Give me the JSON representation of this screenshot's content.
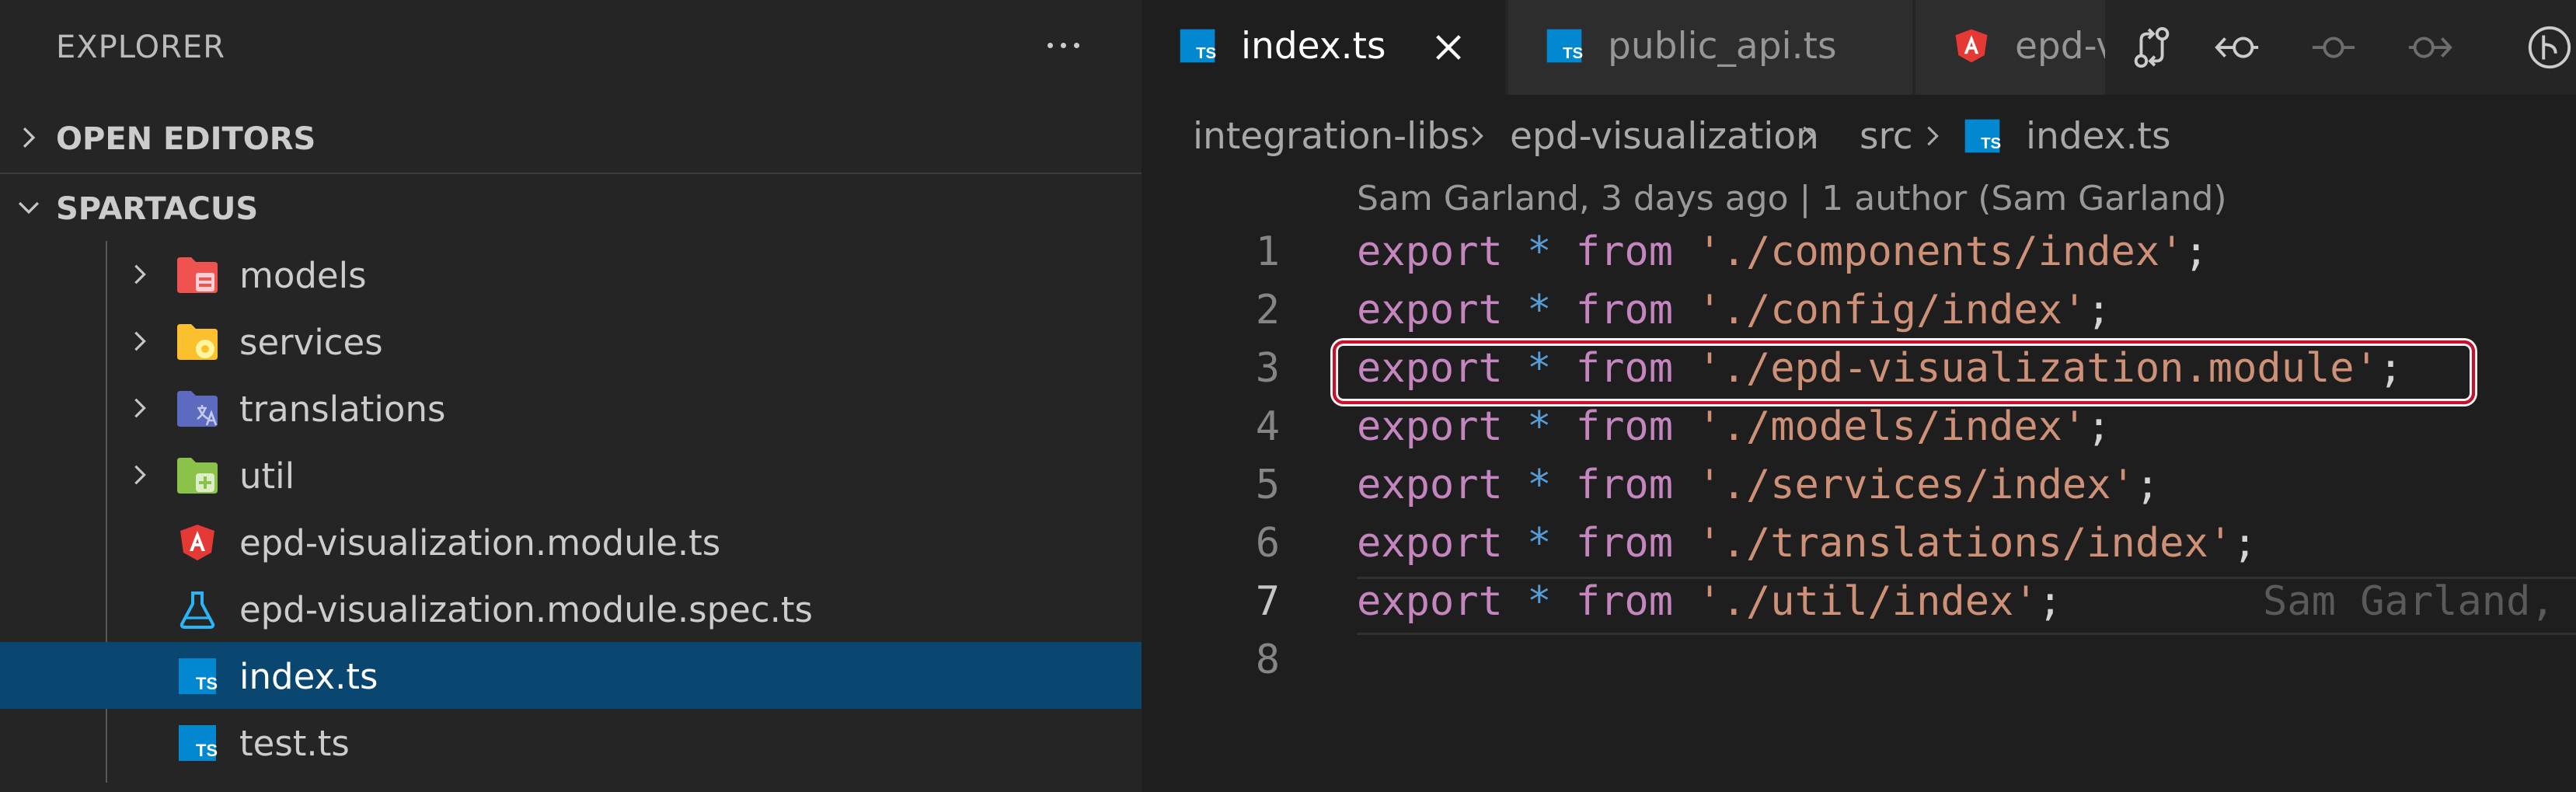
{
  "sidebar": {
    "title": "EXPLORER",
    "more_actions_icon": "ellipsis-icon",
    "sections": {
      "open_editors": {
        "label": "OPEN EDITORS",
        "expanded": false
      },
      "workspace": {
        "label": "SPARTACUS",
        "expanded": true
      }
    },
    "tree": [
      {
        "name": "models",
        "kind": "folder",
        "icon": "folder-models-icon",
        "color": "#ef5350"
      },
      {
        "name": "services",
        "kind": "folder",
        "icon": "folder-services-icon",
        "color": "#fbc02d"
      },
      {
        "name": "translations",
        "kind": "folder",
        "icon": "folder-i18n-icon",
        "color": "#5c6bc0"
      },
      {
        "name": "util",
        "kind": "folder",
        "icon": "folder-util-icon",
        "color": "#8bc34a"
      },
      {
        "name": "epd-visualization.module.ts",
        "kind": "file",
        "icon": "angular-icon",
        "color": "#e53935"
      },
      {
        "name": "epd-visualization.module.spec.ts",
        "kind": "file",
        "icon": "test-flask-icon",
        "color": "#29b6f6"
      },
      {
        "name": "index.ts",
        "kind": "file",
        "icon": "typescript-icon",
        "color": "#0288d1",
        "selected": true
      },
      {
        "name": "test.ts",
        "kind": "file",
        "icon": "typescript-icon",
        "color": "#0288d1"
      }
    ]
  },
  "editor": {
    "tabs": [
      {
        "label": "index.ts",
        "icon": "typescript-icon",
        "active": true
      },
      {
        "label": "public_api.ts",
        "icon": "typescript-icon",
        "active": false
      },
      {
        "label": "epd-v",
        "icon": "angular-icon",
        "active": false
      }
    ],
    "actions": [
      "compare-changes-icon",
      "previous-change-icon",
      "commit-icon",
      "next-change-icon",
      "git-graph-icon"
    ],
    "breadcrumb": [
      "integration-libs",
      "epd-visualization",
      "src",
      "index.ts"
    ],
    "codelens": "Sam Garland, 3 days ago | 1 author (Sam Garland)",
    "lines": [
      {
        "n": "1",
        "kw": "export",
        "op": "*",
        "kw2": "from",
        "str": "'./components/index'",
        "end": ";"
      },
      {
        "n": "2",
        "kw": "export",
        "op": "*",
        "kw2": "from",
        "str": "'./config/index'",
        "end": ";"
      },
      {
        "n": "3",
        "kw": "export",
        "op": "*",
        "kw2": "from",
        "str": "'./epd-visualization.module'",
        "end": ";"
      },
      {
        "n": "4",
        "kw": "export",
        "op": "*",
        "kw2": "from",
        "str": "'./models/index'",
        "end": ";"
      },
      {
        "n": "5",
        "kw": "export",
        "op": "*",
        "kw2": "from",
        "str": "'./services/index'",
        "end": ";"
      },
      {
        "n": "6",
        "kw": "export",
        "op": "*",
        "kw2": "from",
        "str": "'./translations/index'",
        "end": ";"
      },
      {
        "n": "7",
        "kw": "export",
        "op": "*",
        "kw2": "from",
        "str": "'./util/index'",
        "end": ";"
      },
      {
        "n": "8",
        "kw": "",
        "op": "",
        "kw2": "",
        "str": "",
        "end": ""
      }
    ],
    "inline_blame": "Sam Garland,",
    "highlighted_line": "3",
    "current_line": "7"
  },
  "colors": {
    "highlight_border": "#c8102e",
    "selection": "#094771",
    "keyword": "#c586c0",
    "string": "#ce9178",
    "operator": "#569cd6"
  }
}
